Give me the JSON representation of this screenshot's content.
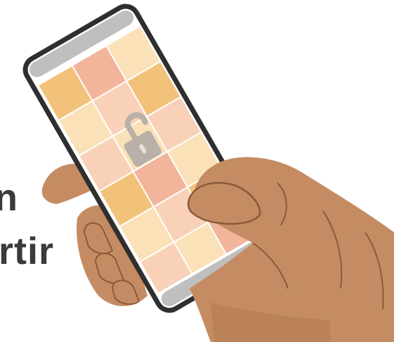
{
  "caption": {
    "line1": "n",
    "line2": "rtir"
  },
  "colors": {
    "skin": "#c58c63",
    "skin_shadow": "#a86f4a",
    "skin_line": "#8a5a3a",
    "phone_frame": "#2f2f2f",
    "phone_bar": "#bfbfbf",
    "tile_orange": "#f3c27a",
    "tile_salmon": "#f2b49a",
    "tile_peach": "#f8d1b8",
    "tile_cream": "#fbe1b7",
    "lock": "#b9b1a8"
  },
  "icons": {
    "lock": "unlocked-padlock-icon"
  }
}
